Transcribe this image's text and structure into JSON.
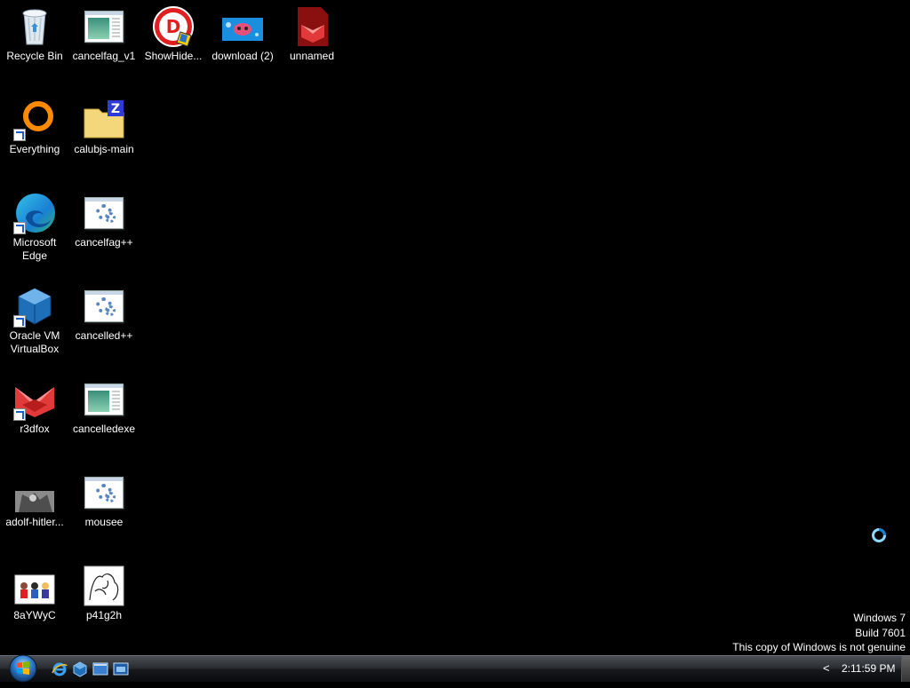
{
  "desktop": {
    "icons": {
      "recycle_bin": "Recycle Bin",
      "cancelfag_v1": "cancelfag_v1",
      "showhide": "ShowHide...",
      "download2": "download (2)",
      "unnamed": "unnamed",
      "everything": "Everything",
      "calubjs_main": "calubjs-main",
      "edge_line1": "Microsoft",
      "edge_line2": "Edge",
      "cancelfagpp": "cancelfag++",
      "vbox_line1": "Oracle VM",
      "vbox_line2": "VirtualBox",
      "cancelledpp": "cancelled++",
      "r3dfox": "r3dfox",
      "cancelledexe": "cancelledexe",
      "adolf": "adolf-hitler...",
      "mousee": "mousee",
      "ayw": "8aYWyC",
      "p41g2h": "p41g2h"
    }
  },
  "watermark": {
    "line1": "Windows 7",
    "line2": "Build 7601",
    "line3": "This copy of Windows is not genuine"
  },
  "taskbar": {
    "tray_chevron": "<",
    "clock": "2:11:59 PM"
  },
  "colors": {
    "desktop_bg": "#000000",
    "taskbar": "#1b1d20",
    "text": "#ffffff"
  }
}
